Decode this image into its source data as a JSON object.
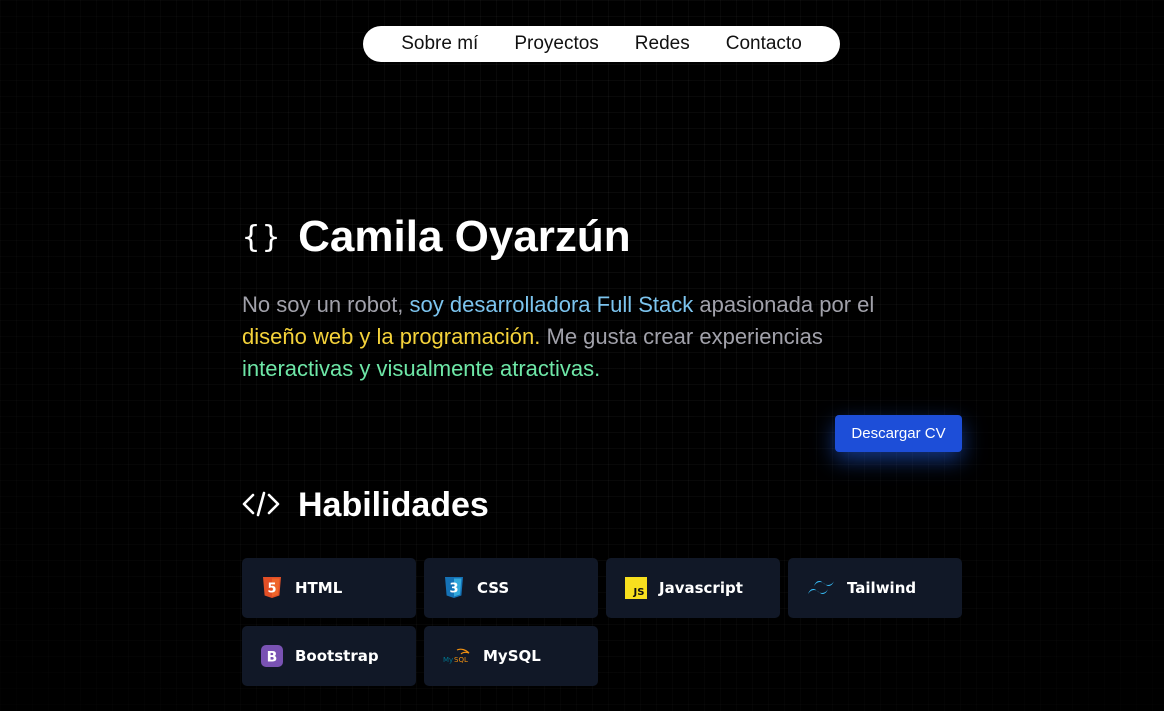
{
  "nav": {
    "items": [
      "Sobre mí",
      "Proyectos",
      "Redes",
      "Contacto"
    ]
  },
  "hero": {
    "braces": "{}",
    "name": "Camila Oyarzún",
    "bio": {
      "p1": "No soy un robot, ",
      "h1": "soy desarrolladora Full Stack",
      "p2": " apasionada por el ",
      "h2": "diseño web y la programación.",
      "p3": " Me gusta crear experiencias ",
      "h3": "interactivas y visualmente atractivas."
    },
    "cv_button": "Descargar CV"
  },
  "skills": {
    "heading": "Habilidades",
    "items": [
      {
        "name": "HTML",
        "icon": "html5-icon"
      },
      {
        "name": "CSS",
        "icon": "css3-icon"
      },
      {
        "name": "Javascript",
        "icon": "javascript-icon"
      },
      {
        "name": "Tailwind",
        "icon": "tailwind-icon"
      },
      {
        "name": "Bootstrap",
        "icon": "bootstrap-icon"
      },
      {
        "name": "MySQL",
        "icon": "mysql-icon"
      }
    ]
  },
  "colors": {
    "background": "#000000",
    "highlight_blue": "#7cc4ee",
    "highlight_yellow": "#f4d23a",
    "highlight_green": "#6ee7a7",
    "button": "#1d4ed8",
    "skill_card": "#111827"
  }
}
